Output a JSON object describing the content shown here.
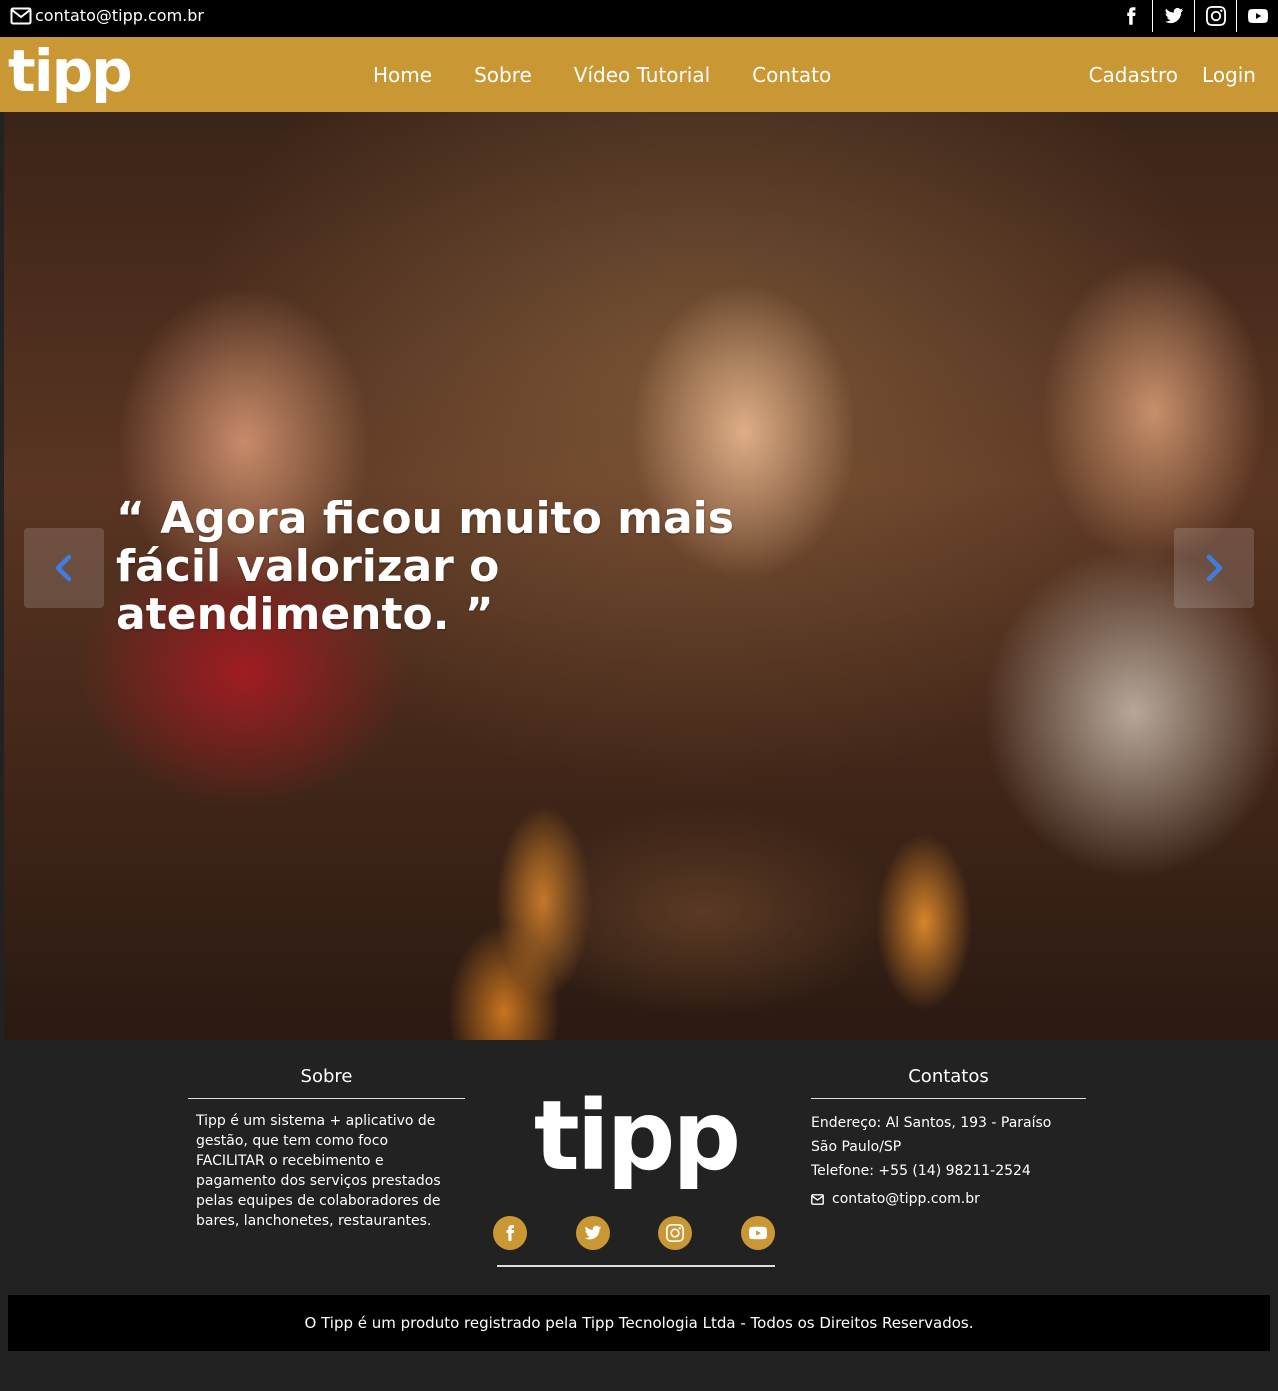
{
  "topbar": {
    "email": "contato@tipp.com.br",
    "socials": [
      "facebook-icon",
      "twitter-icon",
      "instagram-icon",
      "youtube-icon"
    ]
  },
  "nav": {
    "logo": "tipp",
    "menu": [
      "Home",
      "Sobre",
      "Vídeo Tutorial",
      "Contato"
    ],
    "cadastro": "Cadastro",
    "login": "Login"
  },
  "hero": {
    "quote": "“ Agora ficou muito mais fácil valorizar o atendimento. ”"
  },
  "footer": {
    "sobre": {
      "title": "Sobre",
      "text": "Tipp é um sistema + aplicativo de gestão, que tem como foco FACILITAR o recebimento e pagamento dos serviços prestados pelas equipes de colaboradores de bares, lanchonetes, restaurantes."
    },
    "logo": "tipp",
    "contatos": {
      "title": "Contatos",
      "address1": "Endereço: Al Santos, 193 - Paraíso",
      "address2": "São Paulo/SP",
      "phone": "Telefone: +55 (14) 98211-2524",
      "email": "contato@tipp.com.br"
    },
    "copyright": "O Tipp é um produto registrado pela Tipp Tecnologia Ltda - Todos os Direitos Reservados."
  },
  "colors": {
    "brand": "#c99834",
    "topbar": "#000000",
    "footer": "#222222",
    "arrow": "#3d7ee0"
  }
}
